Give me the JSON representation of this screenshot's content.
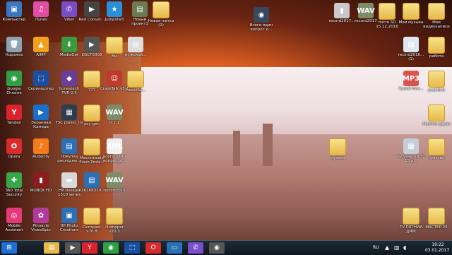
{
  "desktop_icons": [
    {
      "id": "computer",
      "label": "Компьютер",
      "color": "#3a77c2",
      "glyph": "▣"
    },
    {
      "id": "itunes",
      "label": "iTunes",
      "color": "#e04fa5",
      "glyph": "♫"
    },
    {
      "id": "viber",
      "label": "Viber",
      "color": "#7b4ec9",
      "glyph": "✆"
    },
    {
      "id": "red",
      "label": "Red Conver...",
      "color": "#444",
      "glyph": "▶"
    },
    {
      "id": "jumpstart",
      "label": "Jumpstart",
      "color": "#2a8fd9",
      "glyph": "★"
    },
    {
      "id": "new1",
      "label": "Новый проект3",
      "color": "#6a7b52",
      "glyph": "▤"
    },
    {
      "id": "newfolder",
      "label": "Новая папка (2)",
      "color": "#e7b94a",
      "glyph": ""
    },
    {
      "id": "all1",
      "label": "Всего один вопрос д...",
      "color": "#34495e",
      "glyph": "◉"
    },
    {
      "id": "record1",
      "label": "record2017...",
      "color": "#c9c9c9",
      "glyph": "▮"
    },
    {
      "id": "record2",
      "label": "record2017",
      "color": "#7e8b68",
      "glyph": "WAV"
    },
    {
      "id": "micro",
      "label": "micro SD 15.12.2016",
      "color": "#e7b94a",
      "glyph": ""
    },
    {
      "id": "mymusic",
      "label": "Мои музыка",
      "color": "#e7b94a",
      "glyph": ""
    },
    {
      "id": "myvideo",
      "label": "Мои видеозаписи",
      "color": "#e7b94a",
      "glyph": ""
    },
    {
      "id": "trash",
      "label": "Корзина",
      "color": "#8fa3b5",
      "glyph": "🗑"
    },
    {
      "id": "aimp",
      "label": "AIMP",
      "color": "#f0a21f",
      "glyph": "▲"
    },
    {
      "id": "mediaget",
      "label": "MediaGet",
      "color": "#3a9a3e",
      "glyph": "⬇"
    },
    {
      "id": "dsc",
      "label": "DSCF0008",
      "color": "#555",
      "glyph": "▶"
    },
    {
      "id": "bm",
      "label": "бм",
      "color": "#e7b94a",
      "glyph": ""
    },
    {
      "id": "muzhskoi",
      "label": "мужской...",
      "color": "#ddd",
      "glyph": "▤"
    },
    {
      "id": "record3",
      "label": "record2016... (1)",
      "color": "#dfe8f2",
      "glyph": "▤"
    },
    {
      "id": "rabota",
      "label": "работа",
      "color": "#e7b94a",
      "glyph": ""
    },
    {
      "id": "chrome",
      "label": "Google Chrome",
      "color": "#2f9e44",
      "glyph": "◉"
    },
    {
      "id": "skrin",
      "label": "Скриншотер",
      "color": "#1a4fa0",
      "glyph": "⬚"
    },
    {
      "id": "honestech",
      "label": "honestech TVR 2.5",
      "color": "#6a3d9a",
      "glyph": "◆"
    },
    {
      "id": "q777",
      "label": "777",
      "color": "#e7b94a",
      "glyph": ""
    },
    {
      "id": "crazy",
      "label": "CrazyTalk v5.1",
      "color": "#c0392b",
      "glyph": "☺"
    },
    {
      "id": "proekt",
      "label": "ProektSe...",
      "color": "#e7b94a",
      "glyph": ""
    },
    {
      "id": "mp3",
      "label": "Рукий Ник...",
      "color": "#d9534f",
      "glyph": "MP3"
    },
    {
      "id": "pusk",
      "label": "pusk0(4)",
      "color": "#e7b94a",
      "glyph": ""
    },
    {
      "id": "yandex",
      "label": "Yandex",
      "color": "#d9232d",
      "glyph": "Y"
    },
    {
      "id": "ekran",
      "label": "Экранная Камера",
      "color": "#1a6fc7",
      "glyph": "▶"
    },
    {
      "id": "fsc",
      "label": "FSC player_ini",
      "color": "#2c3e50",
      "glyph": "▦"
    },
    {
      "id": "psy",
      "label": "psy-gen",
      "color": "#e7b94a",
      "glyph": ""
    },
    {
      "id": "wav1",
      "label": "0:1:1",
      "color": "#7e8b68",
      "glyph": "WAV"
    },
    {
      "id": "mozh",
      "label": "Можно-сдели",
      "color": "#e7b94a",
      "glyph": ""
    },
    {
      "id": "opera",
      "label": "Opera",
      "color": "#d92b2b",
      "glyph": "O"
    },
    {
      "id": "audacity",
      "label": "Audacity",
      "color": "#f57a1a",
      "glyph": "♪"
    },
    {
      "id": "pokupka",
      "label": "Покупка расходны...",
      "color": "#2b6fb5",
      "glyph": "▤"
    },
    {
      "id": "macro",
      "label": "Macromedia Flash Profe...",
      "color": "#e7b94a",
      "glyph": ""
    },
    {
      "id": "xml",
      "label": "всего один вопрос_д...",
      "color": "#f0f0f0",
      "glyph": "XML"
    },
    {
      "id": "muzika",
      "label": "музика",
      "color": "#e7b94a",
      "glyph": ""
    },
    {
      "id": "chudnie",
      "label": "Чудные ли 32 15 д...",
      "color": "#c5ced6",
      "glyph": "▦"
    },
    {
      "id": "chuvstvo",
      "label": "чувство",
      "color": "#e7b94a",
      "glyph": ""
    },
    {
      "id": "secure",
      "label": "360 Total Security",
      "color": "#37a84a",
      "glyph": "✚"
    },
    {
      "id": "mobox",
      "label": "MOBOX HD",
      "color": "#8b1d1d",
      "glyph": "▮"
    },
    {
      "id": "hp1",
      "label": "HP Deskjet 1510 series",
      "color": "#d8d8d8",
      "glyph": "▬"
    },
    {
      "id": "num",
      "label": "636168339...",
      "color": "#2b6fb5",
      "glyph": "▤"
    },
    {
      "id": "wav2",
      "label": "record2016",
      "color": "#7e8b68",
      "glyph": "WAV"
    },
    {
      "id": "mobile",
      "label": "Mobile Assistant",
      "color": "#e23a7a",
      "glyph": "◎"
    },
    {
      "id": "pinnacle",
      "label": "Pinnacle VideoSpin",
      "color": "#b33a9a",
      "glyph": "✿"
    },
    {
      "id": "hpphoto",
      "label": "HP Photo Creations",
      "color": "#2b6fb5",
      "glyph": "▣"
    },
    {
      "id": "dump1",
      "label": "Dumpper v70.8",
      "color": "#e7b94a",
      "glyph": ""
    },
    {
      "id": "dump2",
      "label": "Dumpper v20.3",
      "color": "#e7b94a",
      "glyph": ""
    },
    {
      "id": "tv",
      "label": "TV ПЯТНИЙ ДЖК",
      "color": "#e7b94a",
      "glyph": ""
    },
    {
      "id": "master",
      "label": "МАСТЕР.26",
      "color": "#e7b94a",
      "glyph": ""
    }
  ],
  "taskbar": {
    "buttons": [
      {
        "id": "start",
        "label": "⊞",
        "color": "#1f6fd6"
      },
      {
        "id": "explorer",
        "label": "▤",
        "color": "#e7b94a"
      },
      {
        "id": "media",
        "label": "▶",
        "color": "#555"
      },
      {
        "id": "yandex",
        "label": "Y",
        "color": "#d9232d"
      },
      {
        "id": "chrome",
        "label": "◉",
        "color": "#2f9e44"
      },
      {
        "id": "screenshot",
        "label": "⬚",
        "color": "#1a4fa0"
      },
      {
        "id": "opera",
        "label": "O",
        "color": "#d92b2b"
      },
      {
        "id": "monitor",
        "label": "▭",
        "color": "#2b6fb5"
      },
      {
        "id": "viber",
        "label": "✆",
        "color": "#7b4ec9"
      },
      {
        "id": "cam",
        "label": "◉",
        "color": "#555"
      }
    ],
    "lang": "RU",
    "time": "19:22",
    "date": "03.01.2017"
  }
}
